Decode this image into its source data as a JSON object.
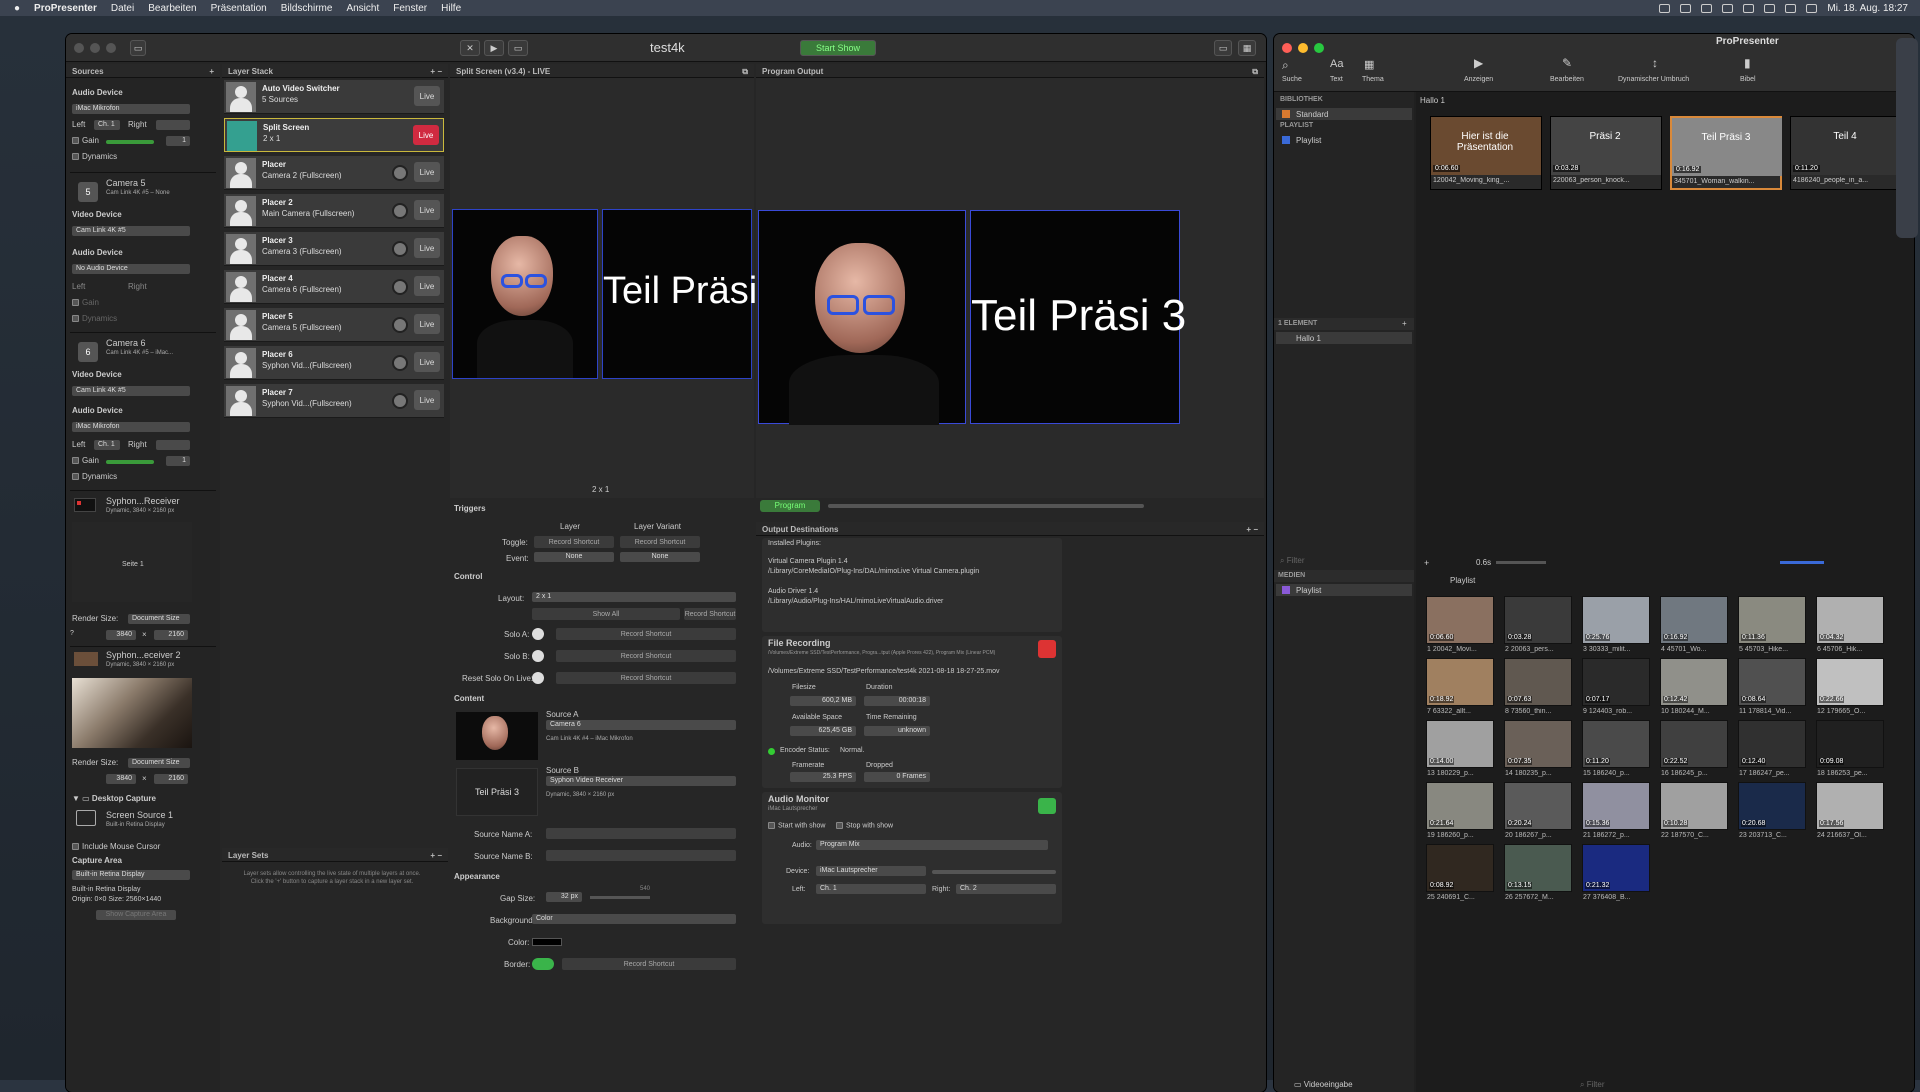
{
  "menubar": {
    "apple": "",
    "app": "ProPresenter",
    "items": [
      "Datei",
      "Bearbeiten",
      "Präsentation",
      "Bildschirme",
      "Ansicht",
      "Fenster",
      "Hilfe"
    ],
    "clock": "Mi. 18. Aug. 18:27"
  },
  "w1": {
    "doc_title": "test4k",
    "start_show": "Start Show"
  },
  "sources": {
    "header": "Sources",
    "audio_device_lbl": "Audio Device",
    "audio_device": "iMac Mikrofon",
    "left": "Left",
    "ch1": "Ch. 1",
    "right": "Right",
    "gain": "Gain",
    "gain_val": "1",
    "dynamics": "Dynamics",
    "cam5": {
      "name": "Camera 5",
      "sub": "Cam Link 4K #5 – None",
      "video_lbl": "Video Device",
      "video": "Cam Link 4K #5",
      "audio_lbl": "Audio Device",
      "audio": "No Audio Device",
      "left": "Left",
      "right": "Right",
      "gain": "Gain",
      "dyn": "Dynamics"
    },
    "cam6": {
      "name": "Camera 6",
      "sub": "Cam Link 4K #5 – iMac...",
      "video_lbl": "Video Device",
      "video": "Cam Link 4K #5",
      "audio_lbl": "Audio Device",
      "audio": "iMac Mikrofon",
      "left": "Left",
      "ch": "Ch. 1",
      "right": "Right",
      "gain": "Gain",
      "gain_val": "1",
      "dyn": "Dynamics"
    },
    "syphon1": {
      "name": "Syphon...Receiver",
      "sub": "Dynamic, 3840 × 2160 px",
      "slide": "Seite 1",
      "render_lbl": "Render Size:",
      "render": "Document Size",
      "w": "3840",
      "x": "×",
      "h": "2160"
    },
    "syphon2": {
      "name": "Syphon...eceiver 2",
      "sub": "Dynamic, 3840 × 2160 px",
      "render_lbl": "Render Size:",
      "render": "Document Size",
      "w": "3840",
      "x": "×",
      "h": "2160"
    },
    "desktop": {
      "section": "Desktop Capture",
      "name": "Screen Source 1",
      "sub": "Built-in Retina Display",
      "mouse": "Include Mouse Cursor",
      "area_lbl": "Capture Area",
      "area": "Built-in Retina Display",
      "info1": "Built-in Retina Display",
      "info2": "Origin: 0×0 Size: 2560×1440",
      "btn": "Show Capture Area"
    }
  },
  "layer_stack": {
    "header": "Layer Stack",
    "layers": [
      {
        "n1": "Auto Video Switcher",
        "n2": "5 Sources",
        "live": "Live"
      },
      {
        "n1": "Split Screen",
        "n2": "2 x 1",
        "live": "Live"
      },
      {
        "n1": "Placer",
        "n2": "Camera 2 (Fullscreen)",
        "live": "Live"
      },
      {
        "n1": "Placer 2",
        "n2": "Main Camera (Fullscreen)",
        "live": "Live"
      },
      {
        "n1": "Placer 3",
        "n2": "Camera 3 (Fullscreen)",
        "live": "Live"
      },
      {
        "n1": "Placer 4",
        "n2": "Camera 6 (Fullscreen)",
        "live": "Live"
      },
      {
        "n1": "Placer 5",
        "n2": "Camera 5 (Fullscreen)",
        "live": "Live"
      },
      {
        "n1": "Placer 6",
        "n2": "Syphon Vid...(Fullscreen)",
        "live": "Live"
      },
      {
        "n1": "Placer 7",
        "n2": "Syphon Vid...(Fullscreen)",
        "live": "Live"
      }
    ],
    "sets_header": "Layer Sets",
    "sets_help": "Layer sets allow controlling the live state of multiple layers at once. Click the '+' button to capture a layer stack in a new layer set."
  },
  "split": {
    "header": "Split Screen (v3.4) - LIVE",
    "text": "Teil Präsi 3",
    "layout_caption": "2 x 1",
    "triggers": {
      "h": "Triggers",
      "col1": "Layer",
      "col2": "Layer Variant",
      "toggle": "Toggle:",
      "event": "Event:",
      "rec": "Record Shortcut",
      "none": "None"
    },
    "control": {
      "h": "Control",
      "layout_lbl": "Layout:",
      "layout": "2 x 1",
      "show_all": "Show All",
      "rec": "Record Shortcut",
      "solo_a": "Solo A:",
      "solo_b": "Solo B:",
      "reset": "Reset Solo On Live:"
    },
    "content": {
      "h": "Content",
      "src_a": "Source A",
      "src_a_val": "Camera 6",
      "src_a_sub": "Cam Link 4K #4 – iMac Mikrofon",
      "src_b": "Source B",
      "src_b_val": "Syphon Video Receiver",
      "src_b_sub": "Dynamic, 3840 × 2160 px",
      "thumb_b": "Teil Präsi 3",
      "name_a": "Source Name A:",
      "name_b": "Source Name B:"
    },
    "appearance": {
      "h": "Appearance",
      "gap": "Gap Size:",
      "gap_val": "32 px",
      "gap_max": "540",
      "bg": "Background:",
      "bg_val": "Color",
      "color": "Color:",
      "border": "Border:",
      "rec": "Record Shortcut"
    }
  },
  "program": {
    "header": "Program Output",
    "text": "Teil Präsi 3",
    "tab": "Program",
    "dest_h": "Output Destinations",
    "plugins": {
      "h": "Installed Plugins:",
      "l1": "Virtual Camera Plugin 1.4",
      "l2": "/Library/CoreMediaIO/Plug-Ins/DAL/mimoLive Virtual Camera.plugin",
      "l3": "Audio Driver 1.4",
      "l4": "/Library/Audio/Plug-Ins/HAL/mimoLiveVirtualAudio.driver"
    },
    "file": {
      "h": "File Recording",
      "sub": "/Volumes/Extreme SSD/TestPerformance, Progra...tput (Apple Prores 422), Program Mix (Linear PCM)",
      "path": "/Volumes/Extreme SSD/TestPerformance/test4k 2021-08-18 18-27-25.mov",
      "fs_l": "Filesize",
      "fs": "600,2 MB",
      "du_l": "Duration",
      "du": "00:00:18",
      "av_l": "Available Space",
      "av": "625,45 GB",
      "tr_l": "Time Remaining",
      "tr": "unknown",
      "enc": "Encoder Status:",
      "enc_v": "Normal.",
      "fr_l": "Framerate",
      "fr": "25.3 FPS",
      "dr_l": "Dropped",
      "dr": "0 Frames"
    },
    "audio": {
      "h": "Audio Monitor",
      "sub": "iMac Lautsprecher",
      "start": "Start with show",
      "stop": "Stop with show",
      "audio_l": "Audio:",
      "audio": "Program Mix",
      "dev_l": "Device:",
      "dev": "iMac Lautsprecher",
      "left_l": "Left:",
      "left": "Ch. 1",
      "right_l": "Right:",
      "right": "Ch. 2"
    }
  },
  "pp": {
    "title": "ProPresenter",
    "tools": [
      "Suche",
      "Text",
      "Thema"
    ],
    "tools2": [
      "Anzeigen",
      "Bearbeiten",
      "Dynamischer Umbruch",
      "Bibel"
    ],
    "lib_h": "BIBLIOTHEK",
    "lib_item": "Standard",
    "pl_h": "PLAYLIST",
    "pl_item": "Playlist",
    "pres_name": "Hallo 1",
    "slides": [
      {
        "label": "Hier ist die Präsentation",
        "dur": "0:06.60",
        "name": "120042_Moving_king_..."
      },
      {
        "label": "Präsi 2",
        "dur": "0:03.28",
        "name": "220063_person_knock..."
      },
      {
        "label": "Teil Präsi 3",
        "dur": "0:16.92",
        "name": "345701_Woman_walkin..."
      },
      {
        "label": "Teil 4",
        "dur": "0:11.20",
        "name": "4186240_people_in_a..."
      }
    ],
    "el_h": "1 ELEMENT",
    "el_item": "Hallo 1",
    "filter": "Filter",
    "speed": "0.6s",
    "med_h": "MEDIEN",
    "med_item": "Playlist",
    "med_pl": "Playlist",
    "vid_in": "Videoeingabe",
    "filter2": "Filter",
    "media": [
      {
        "d": "0:06.60",
        "n": "1 20042_Movi..."
      },
      {
        "d": "0:03.28",
        "n": "2 20063_pers..."
      },
      {
        "d": "0:25.76",
        "n": "3 30333_milit..."
      },
      {
        "d": "0:16.92",
        "n": "4 45701_Wo..."
      },
      {
        "d": "0:11.36",
        "n": "5 45703_Hike..."
      },
      {
        "d": "0:04.32",
        "n": "6 45706_Hik..."
      },
      {
        "d": "0:18.92",
        "n": "7 63322_allt..."
      },
      {
        "d": "0:07.63",
        "n": "8 73560_thin..."
      },
      {
        "d": "0:07.17",
        "n": "9 124403_rob..."
      },
      {
        "d": "0:12.42",
        "n": "10 180244_M..."
      },
      {
        "d": "0:08.64",
        "n": "11 178814_Vid..."
      },
      {
        "d": "0:22.66",
        "n": "12 179665_O..."
      },
      {
        "d": "0:14.00",
        "n": "13 180229_p..."
      },
      {
        "d": "0:07.35",
        "n": "14 180235_p..."
      },
      {
        "d": "0:11.20",
        "n": "15 186240_p..."
      },
      {
        "d": "0:22.52",
        "n": "16 186245_p..."
      },
      {
        "d": "0:12.40",
        "n": "17 186247_pe..."
      },
      {
        "d": "0:09.08",
        "n": "18 186253_pe..."
      },
      {
        "d": "0:21.64",
        "n": "19 186260_p..."
      },
      {
        "d": "0:20.24",
        "n": "20 186267_p..."
      },
      {
        "d": "0:15.36",
        "n": "21 186272_p..."
      },
      {
        "d": "0:10.28",
        "n": "22 187570_C..."
      },
      {
        "d": "0:20.68",
        "n": "23 203713_C..."
      },
      {
        "d": "0:17.56",
        "n": "24 216637_Ol..."
      },
      {
        "d": "0:08.92",
        "n": "25 240691_C..."
      },
      {
        "d": "0:13.15",
        "n": "26 257672_M..."
      },
      {
        "d": "0:21.32",
        "n": "27 376408_B..."
      }
    ]
  }
}
